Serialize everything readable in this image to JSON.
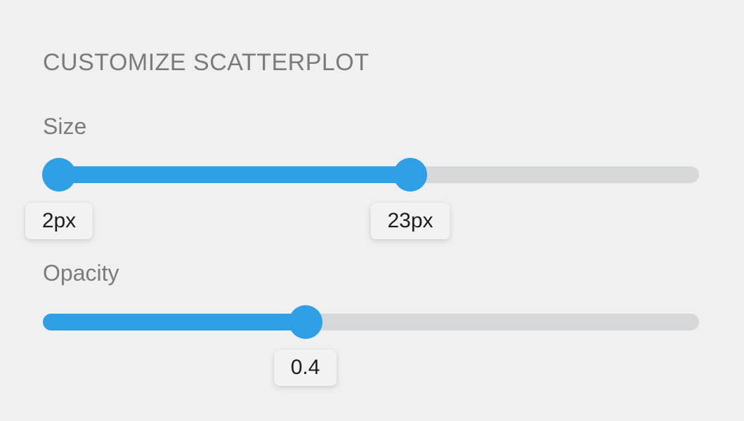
{
  "panel": {
    "title": "CUSTOMIZE SCATTERPLOT"
  },
  "size_slider": {
    "label": "Size",
    "min_label": "2px",
    "max_label": "23px",
    "range_start_fraction": 0.0,
    "range_end_fraction": 0.56
  },
  "opacity_slider": {
    "label": "Opacity",
    "value_label": "0.4",
    "value_fraction": 0.4
  },
  "colors": {
    "accent": "#2f9fe6",
    "track": "#d6d7d9",
    "label_text": "#7b7b7b",
    "background": "#f0f0f0"
  }
}
